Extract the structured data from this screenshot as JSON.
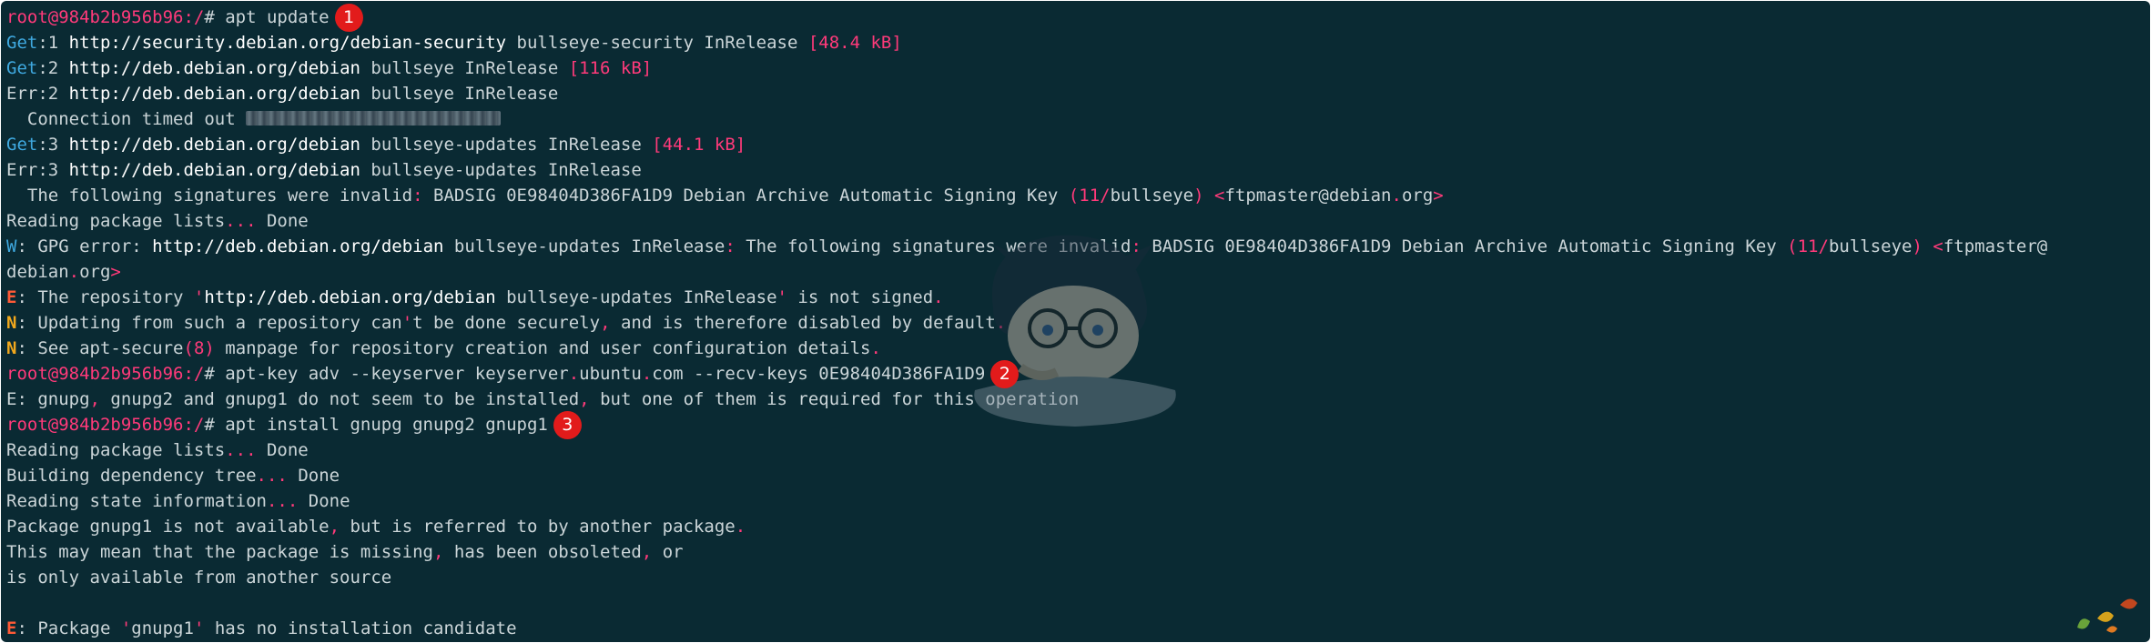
{
  "terminal": {
    "lines": [
      [
        {
          "t": "root@984b2b956b96:/",
          "c": "prompt"
        },
        {
          "t": "# apt update",
          "c": "default"
        }
      ],
      [
        {
          "t": "Get",
          "c": "get"
        },
        {
          "t": ":1 ",
          "c": "default"
        },
        {
          "t": "http://security.debian.org/debian-security",
          "c": "url"
        },
        {
          "t": " bullseye-security InRelease ",
          "c": "default"
        },
        {
          "t": "[48.4 kB]",
          "c": "size"
        }
      ],
      [
        {
          "t": "Get",
          "c": "get"
        },
        {
          "t": ":2 ",
          "c": "default"
        },
        {
          "t": "http://deb.debian.org/debian",
          "c": "url"
        },
        {
          "t": " bullseye InRelease ",
          "c": "default"
        },
        {
          "t": "[116 kB]",
          "c": "size"
        }
      ],
      [
        {
          "t": "Err:2 ",
          "c": "default"
        },
        {
          "t": "http://deb.debian.org/debian",
          "c": "url"
        },
        {
          "t": " bullseye InRelease",
          "c": "default"
        }
      ],
      [
        {
          "t": "  Connection timed out ",
          "c": "default"
        },
        {
          "blur": 280
        }
      ],
      [
        {
          "t": "Get",
          "c": "get"
        },
        {
          "t": ":3 ",
          "c": "default"
        },
        {
          "t": "http://deb.debian.org/debian",
          "c": "url"
        },
        {
          "t": " bullseye-updates InRelease ",
          "c": "default"
        },
        {
          "t": "[44.1 kB]",
          "c": "size"
        }
      ],
      [
        {
          "t": "Err:3 ",
          "c": "default"
        },
        {
          "t": "http://deb.debian.org/debian",
          "c": "url"
        },
        {
          "t": " bullseye-updates InRelease",
          "c": "default"
        }
      ],
      [
        {
          "t": "  The following signatures were invalid",
          "c": "default"
        },
        {
          "t": ":",
          "c": "punct"
        },
        {
          "t": " BADSIG 0E98404D386FA1D9 Debian Archive Automatic Signing Key ",
          "c": "default"
        },
        {
          "t": "(",
          "c": "punct"
        },
        {
          "t": "11",
          "c": "num"
        },
        {
          "t": "/",
          "c": "punct"
        },
        {
          "t": "bullseye",
          "c": "default"
        },
        {
          "t": ")",
          "c": "punct"
        },
        {
          "t": " ",
          "c": "default"
        },
        {
          "t": "<",
          "c": "punct"
        },
        {
          "t": "ftpmaster@debian",
          "c": "default"
        },
        {
          "t": ".",
          "c": "punct"
        },
        {
          "t": "org",
          "c": "default"
        },
        {
          "t": ">",
          "c": "punct"
        }
      ],
      [
        {
          "t": "Reading package lists",
          "c": "default"
        },
        {
          "t": "...",
          "c": "punct"
        },
        {
          "t": " Done",
          "c": "default"
        }
      ],
      [
        {
          "t": "W",
          "c": "w"
        },
        {
          "t": ": GPG error: ",
          "c": "default"
        },
        {
          "t": "http://deb.debian.org/debian",
          "c": "url"
        },
        {
          "t": " bullseye-updates InRelease",
          "c": "default"
        },
        {
          "t": ":",
          "c": "punct"
        },
        {
          "t": " The following signatures were invalid",
          "c": "default"
        },
        {
          "t": ":",
          "c": "punct"
        },
        {
          "t": " BADSIG 0E98404D386FA1D9 Debian Archive Automatic Signing Key ",
          "c": "default"
        },
        {
          "t": "(",
          "c": "punct"
        },
        {
          "t": "11",
          "c": "num"
        },
        {
          "t": "/",
          "c": "punct"
        },
        {
          "t": "bullseye",
          "c": "default"
        },
        {
          "t": ")",
          "c": "punct"
        },
        {
          "t": " ",
          "c": "default"
        },
        {
          "t": "<",
          "c": "punct"
        },
        {
          "t": "ftpmaster@",
          "c": "default"
        }
      ],
      [
        {
          "t": "debian",
          "c": "default"
        },
        {
          "t": ".",
          "c": "punct"
        },
        {
          "t": "org",
          "c": "default"
        },
        {
          "t": ">",
          "c": "punct"
        }
      ],
      [
        {
          "t": "E",
          "c": "e"
        },
        {
          "t": ": The repository ",
          "c": "default"
        },
        {
          "t": "'",
          "c": "punct"
        },
        {
          "t": "http://deb.debian.org/debian",
          "c": "url"
        },
        {
          "t": " bullseye-updates InRelease",
          "c": "default"
        },
        {
          "t": "'",
          "c": "punct"
        },
        {
          "t": " is not signed",
          "c": "default"
        },
        {
          "t": ".",
          "c": "punct"
        }
      ],
      [
        {
          "t": "N",
          "c": "n"
        },
        {
          "t": ": Updating from such a repository can",
          "c": "default"
        },
        {
          "t": "'",
          "c": "punct"
        },
        {
          "t": "t be done securely",
          "c": "default"
        },
        {
          "t": ",",
          "c": "punct"
        },
        {
          "t": " and is therefore disabled by default",
          "c": "default"
        },
        {
          "t": ".",
          "c": "punct"
        }
      ],
      [
        {
          "t": "N",
          "c": "n"
        },
        {
          "t": ": See apt-secure",
          "c": "default"
        },
        {
          "t": "(",
          "c": "punct"
        },
        {
          "t": "8",
          "c": "num"
        },
        {
          "t": ")",
          "c": "punct"
        },
        {
          "t": " manpage for repository creation and user configuration details",
          "c": "default"
        },
        {
          "t": ".",
          "c": "punct"
        }
      ],
      [
        {
          "t": "root@984b2b956b96:/",
          "c": "prompt"
        },
        {
          "t": "# apt-key adv --keyserver keyserver",
          "c": "default"
        },
        {
          "t": ".",
          "c": "punct"
        },
        {
          "t": "ubuntu",
          "c": "default"
        },
        {
          "t": ".",
          "c": "punct"
        },
        {
          "t": "com --recv-keys 0E98404D386FA1D9",
          "c": "default"
        }
      ],
      [
        {
          "t": "E: gnupg",
          "c": "default"
        },
        {
          "t": ",",
          "c": "punct"
        },
        {
          "t": " gnupg2 and gnupg1 do not seem to be installed",
          "c": "default"
        },
        {
          "t": ",",
          "c": "punct"
        },
        {
          "t": " but one of them is required for this operation",
          "c": "default"
        }
      ],
      [
        {
          "t": "root@984b2b956b96:/",
          "c": "prompt"
        },
        {
          "t": "# apt install gnupg gnupg2 gnupg1",
          "c": "default"
        }
      ],
      [
        {
          "t": "Reading package lists",
          "c": "default"
        },
        {
          "t": "...",
          "c": "punct"
        },
        {
          "t": " Done",
          "c": "default"
        }
      ],
      [
        {
          "t": "Building dependency tree",
          "c": "default"
        },
        {
          "t": "...",
          "c": "punct"
        },
        {
          "t": " Done",
          "c": "default"
        }
      ],
      [
        {
          "t": "Reading state information",
          "c": "default"
        },
        {
          "t": "...",
          "c": "punct"
        },
        {
          "t": " Done",
          "c": "default"
        }
      ],
      [
        {
          "t": "Package gnupg1 is not available",
          "c": "default"
        },
        {
          "t": ",",
          "c": "punct"
        },
        {
          "t": " but is referred to by another package",
          "c": "default"
        },
        {
          "t": ".",
          "c": "punct"
        }
      ],
      [
        {
          "t": "This may mean that the package is missing",
          "c": "default"
        },
        {
          "t": ",",
          "c": "punct"
        },
        {
          "t": " has been obsoleted",
          "c": "default"
        },
        {
          "t": ",",
          "c": "punct"
        },
        {
          "t": " or",
          "c": "default"
        }
      ],
      [
        {
          "t": "is only available from another source",
          "c": "default"
        }
      ],
      [],
      [
        {
          "t": "E",
          "c": "e"
        },
        {
          "t": ": Package ",
          "c": "default"
        },
        {
          "t": "'",
          "c": "punct"
        },
        {
          "t": "gnupg1",
          "c": "default"
        },
        {
          "t": "'",
          "c": "punct"
        },
        {
          "t": " has no installation candidate",
          "c": "default"
        }
      ]
    ]
  },
  "markers": [
    {
      "label": "1",
      "line": 0
    },
    {
      "label": "2",
      "line": 14
    },
    {
      "label": "3",
      "line": 16
    }
  ],
  "colors": {
    "background": "#0a2a33",
    "prompt": "#ff3a7a",
    "get": "#3fa9e0",
    "url": "#ffffff",
    "marker": "#e21b1b",
    "error": "#ff5a36",
    "notice": "#f2a81d"
  },
  "icons": {
    "watermark": "anime-character-watermark-icon",
    "corner": "leaves-decoration-icon"
  }
}
